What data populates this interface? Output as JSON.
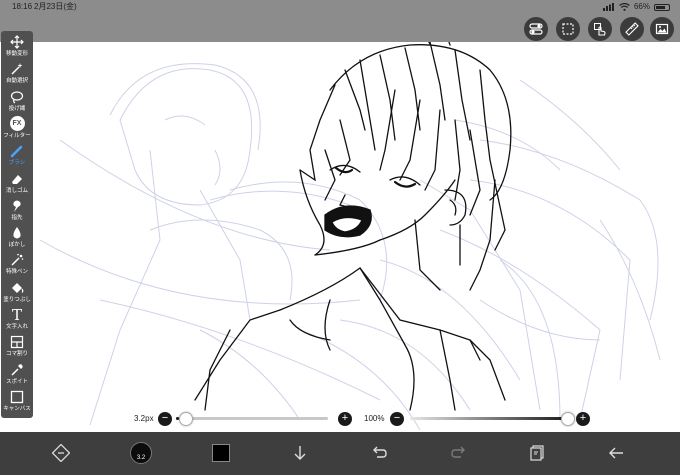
{
  "status_bar": {
    "time": "18:16",
    "date": "2月23日(金)",
    "battery_percent": "66%",
    "battery_level": 0.66
  },
  "top_toolbar": {
    "buttons": [
      {
        "icon": "toggle-icon"
      },
      {
        "icon": "selection-icon"
      },
      {
        "icon": "hand-gesture-icon"
      },
      {
        "icon": "ruler-icon"
      },
      {
        "icon": "image-icon"
      }
    ]
  },
  "tools": [
    {
      "label": "移動変形",
      "icon": "move-icon",
      "active": false
    },
    {
      "label": "自動選択",
      "icon": "magic-wand-icon",
      "active": false
    },
    {
      "label": "投げ縄",
      "icon": "lasso-icon",
      "active": false
    },
    {
      "label": "フィルター",
      "icon": "filter-icon",
      "icon_text": "FX",
      "active": false
    },
    {
      "label": "ブラシ",
      "icon": "brush-icon",
      "active": true
    },
    {
      "label": "消しゴム",
      "icon": "eraser-icon",
      "active": false
    },
    {
      "label": "指先",
      "icon": "smudge-icon",
      "active": false
    },
    {
      "label": "ぼかし",
      "icon": "blur-icon",
      "active": false
    },
    {
      "label": "特殊ペン",
      "icon": "special-pen-icon",
      "active": false
    },
    {
      "label": "塗りつぶし",
      "icon": "fill-bucket-icon",
      "active": false
    },
    {
      "label": "文字入れ",
      "icon": "text-icon",
      "icon_text": "T",
      "active": false
    },
    {
      "label": "コマ割り",
      "icon": "panel-divide-icon",
      "active": false
    },
    {
      "label": "スポイト",
      "icon": "eyedropper-icon",
      "active": false
    },
    {
      "label": "キャンバス",
      "icon": "canvas-icon",
      "active": false
    }
  ],
  "brush_size": {
    "label": "3.2px",
    "minus": "−",
    "plus": "+",
    "level": 0.02
  },
  "opacity": {
    "label": "100%",
    "minus": "−",
    "plus": "+",
    "level": 1.0
  },
  "bottom_toolbar": {
    "buttons": [
      {
        "icon": "transform-icon"
      },
      {
        "icon": "brush-preview-icon",
        "text": "3.2"
      },
      {
        "icon": "color-swatch-icon",
        "color": "#000000"
      },
      {
        "icon": "download-arrow-icon"
      },
      {
        "icon": "undo-icon"
      },
      {
        "icon": "redo-icon"
      },
      {
        "icon": "layers-icon"
      },
      {
        "icon": "back-arrow-icon"
      }
    ]
  },
  "colors": {
    "toolbar_bg": "#505050",
    "active_tool": "#4aa3ff",
    "status_bg": "#8c8c8c",
    "bottom_bg": "#3e3e3e",
    "sketch_blue": "#c9cde6"
  }
}
